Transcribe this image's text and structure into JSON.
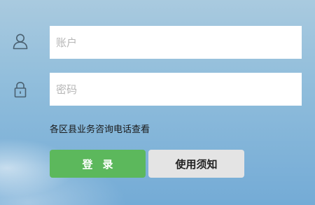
{
  "login_form": {
    "username_placeholder": "账户",
    "username_value": "",
    "password_placeholder": "密码",
    "password_value": "",
    "hint_text": "各区县业务咨询电话查看",
    "login_button_label": "登录",
    "notice_button_label": "使用须知"
  },
  "icons": {
    "user": "user-icon",
    "lock": "lock-icon"
  },
  "colors": {
    "login_button": "#5cb85c",
    "notice_button": "#e4e4e4",
    "icon_stroke": "#4a6070"
  }
}
